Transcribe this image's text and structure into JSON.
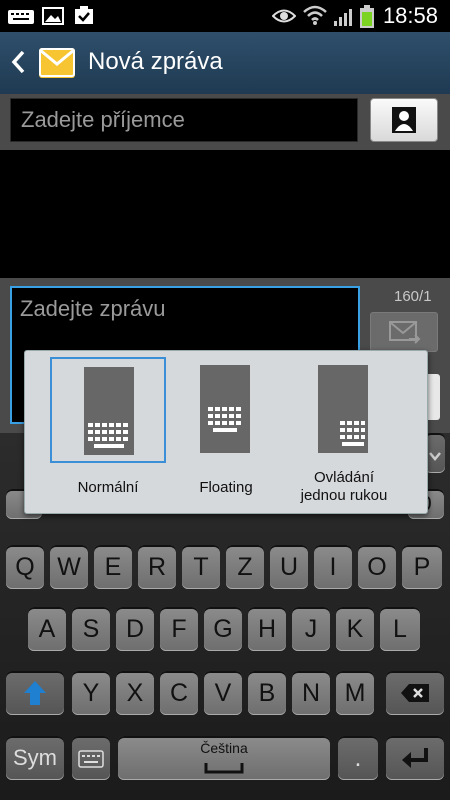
{
  "status_bar": {
    "time": "18:58"
  },
  "action_bar": {
    "title": "Nová zpráva"
  },
  "recipient": {
    "placeholder": "Zadejte příjemce"
  },
  "message": {
    "placeholder": "Zadejte zprávu",
    "counter": "160/1"
  },
  "keyboard_mode_popup": {
    "options": [
      {
        "label": "Normální",
        "selected": true
      },
      {
        "label": "Floating",
        "selected": false
      },
      {
        "label": "Ovládání\njednou rukou",
        "selected": false
      }
    ]
  },
  "keyboard": {
    "row1": [
      "Q",
      "W",
      "E",
      "R",
      "T",
      "Z",
      "U",
      "I",
      "O",
      "P"
    ],
    "row2": [
      "A",
      "S",
      "D",
      "F",
      "G",
      "H",
      "J",
      "K",
      "L"
    ],
    "row3": [
      "Y",
      "X",
      "C",
      "V",
      "B",
      "N",
      "M"
    ],
    "bottom": {
      "sym": "Sym",
      "language": "Čeština",
      "punct": "."
    }
  },
  "colors": {
    "accent": "#3aa0e6",
    "action_bar": "#2f4f6b"
  }
}
